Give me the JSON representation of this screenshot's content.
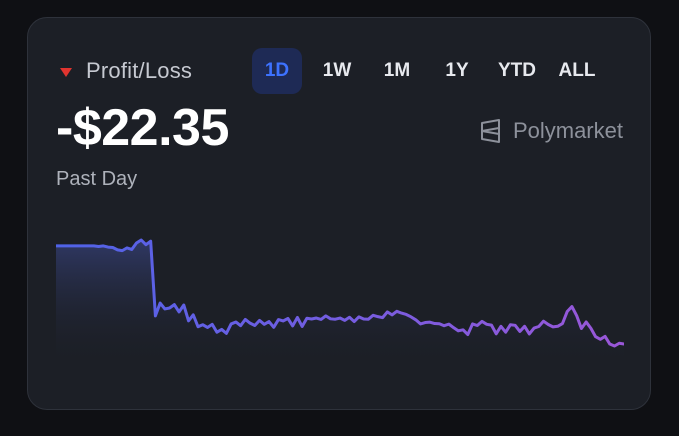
{
  "widget": {
    "title": "Profit/Loss",
    "value": "-$22.35",
    "period_label": "Past Day",
    "brand": "Polymarket",
    "colors": {
      "negative": "#e0342f",
      "accent": "#3d72ff",
      "line_start": "#4f63e8",
      "line_end": "#9a57d8"
    },
    "tabs": [
      {
        "label": "1D",
        "active": true
      },
      {
        "label": "1W",
        "active": false
      },
      {
        "label": "1M",
        "active": false
      },
      {
        "label": "1Y",
        "active": false
      },
      {
        "label": "YTD",
        "active": false
      },
      {
        "label": "ALL",
        "active": false
      }
    ]
  },
  "chart_data": {
    "type": "area",
    "values": [
      50,
      50,
      50,
      50,
      50,
      50,
      50,
      50,
      50,
      49.7,
      50,
      49.4,
      49.2,
      48,
      47.6,
      49,
      48.2,
      51.5,
      53,
      50.6,
      52.4,
      14.5,
      21,
      18,
      18.5,
      20.2,
      16.5,
      20,
      12,
      15,
      9,
      10,
      8.6,
      10.2,
      6.2,
      7.6,
      5.6,
      10.4,
      11.4,
      9.5,
      12.7,
      10.8,
      9.6,
      12.2,
      10.2,
      11.6,
      8.7,
      12.6,
      11.9,
      13.2,
      9.4,
      13.7,
      9.1,
      13.3,
      12.9,
      13.4,
      12.7,
      14.5,
      13,
      12.8,
      13.4,
      12.2,
      13.8,
      11.6,
      14,
      12.9,
      12.8,
      14.8,
      14.1,
      13.6,
      16.5,
      15,
      16.8,
      15.9,
      15.2,
      14,
      12.5,
      10.4,
      11.1,
      11.3,
      10.6,
      10.5,
      9.5,
      10.3,
      8.5,
      6.9,
      7.4,
      5,
      10.4,
      9.6,
      11.7,
      10.2,
      9.8,
      5.4,
      9.2,
      6.2,
      10,
      9.7,
      6.6,
      9.2,
      5.3,
      8.3,
      9.1,
      11.8,
      10.1,
      8.9,
      9.2,
      10.6,
      16.7,
      19.2,
      14.6,
      8.1,
      11.4,
      8.2,
      3.9,
      2.6,
      4.1,
      0.2,
      -0.8,
      0.6,
      0.2
    ]
  }
}
